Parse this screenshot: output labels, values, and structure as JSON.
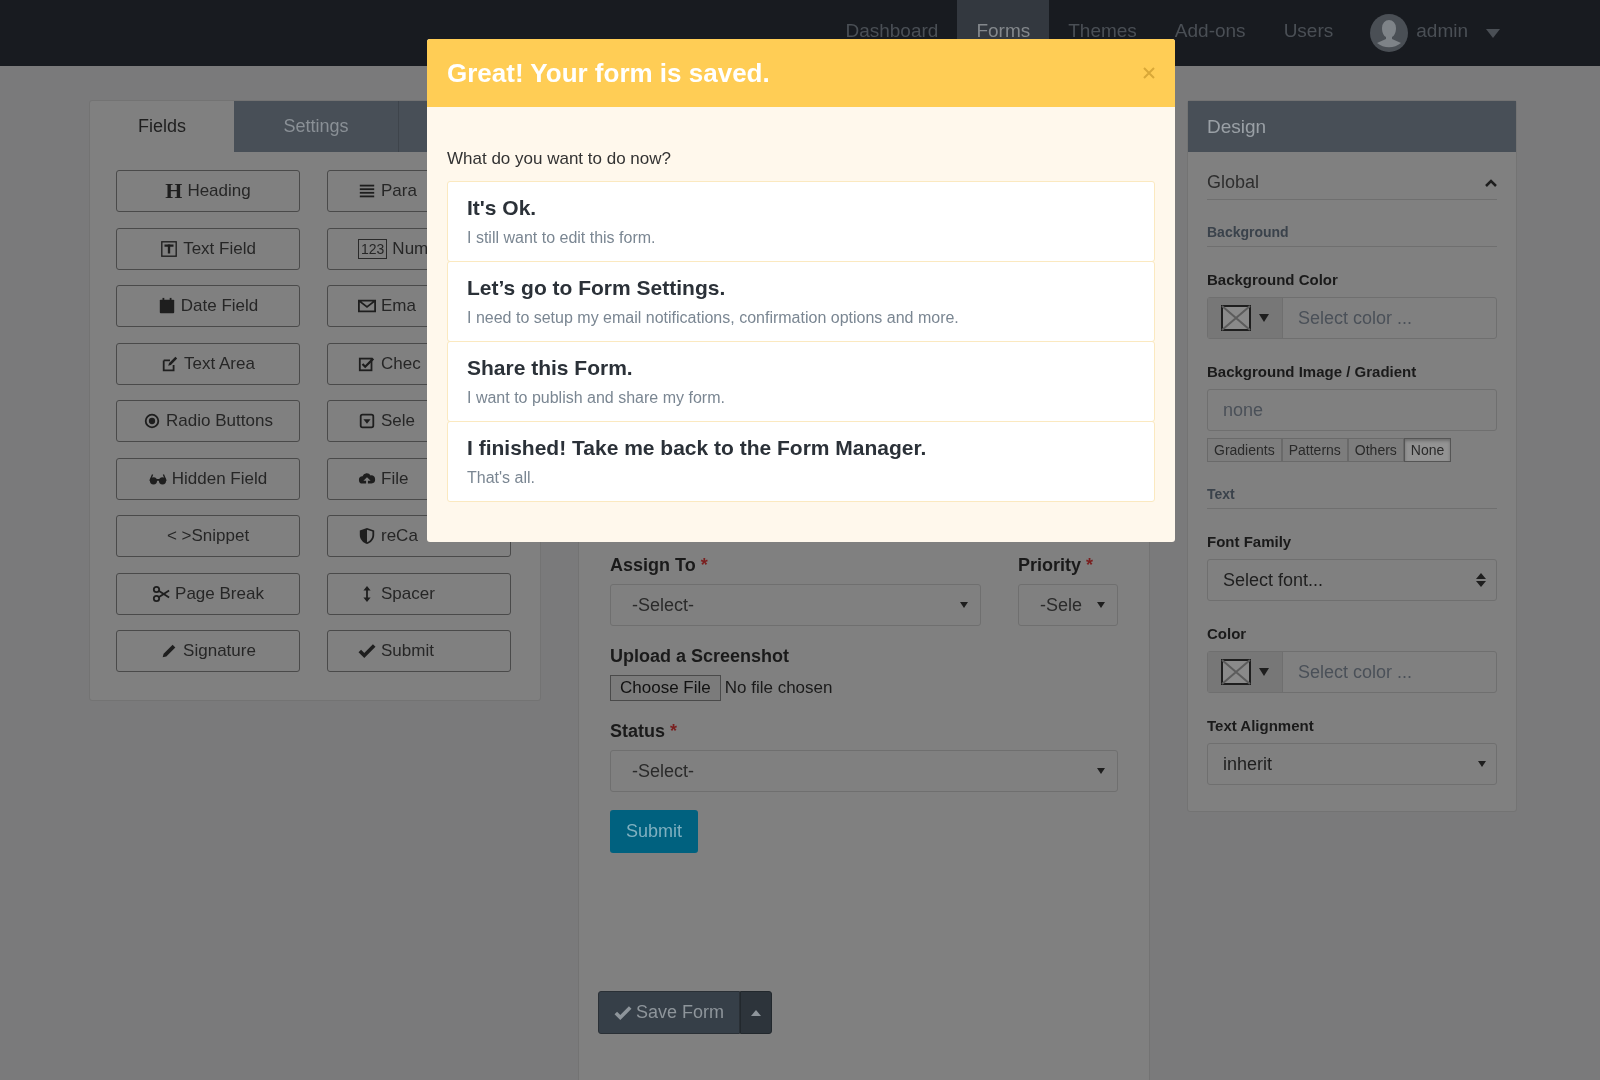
{
  "nav": {
    "items": [
      {
        "label": "Dashboard",
        "selected": false
      },
      {
        "label": "Forms",
        "selected": true
      },
      {
        "label": "Themes",
        "selected": false
      },
      {
        "label": "Add-ons",
        "selected": false
      },
      {
        "label": "Users",
        "selected": false
      }
    ],
    "user": "admin"
  },
  "builder": {
    "tabs": [
      {
        "label": "Fields",
        "selected": true
      },
      {
        "label": "Settings",
        "selected": false
      }
    ],
    "fields": [
      {
        "label": "Heading",
        "kind": "glyph",
        "glyph": "H"
      },
      {
        "label": "Para",
        "kind": "paragraph"
      },
      {
        "label": "Text Field",
        "kind": "textfield"
      },
      {
        "label": "Num",
        "kind": "boxed",
        "glyph": "123"
      },
      {
        "label": "Date Field",
        "kind": "calendar"
      },
      {
        "label": "Ema",
        "kind": "envelope"
      },
      {
        "label": "Text Area",
        "kind": "edit"
      },
      {
        "label": "Chec",
        "kind": "checkbox"
      },
      {
        "label": "Radio Buttons",
        "kind": "radio"
      },
      {
        "label": "Sele",
        "kind": "select"
      },
      {
        "label": "Hidden Field",
        "kind": "glasses"
      },
      {
        "label": "File",
        "kind": "upload"
      },
      {
        "label": "< >Snippet",
        "kind": "plain"
      },
      {
        "label": "reCa",
        "kind": "shield"
      },
      {
        "label": "Page Break",
        "kind": "scissors"
      },
      {
        "label": "Spacer",
        "kind": "updown"
      },
      {
        "label": "Signature",
        "kind": "pencil"
      },
      {
        "label": "Submit",
        "kind": "check"
      }
    ]
  },
  "form": {
    "assign_to": {
      "label": "Assign To",
      "required_mark": "*",
      "value": "-Select-"
    },
    "priority": {
      "label": "Priority",
      "required_mark": "*",
      "value": "-Sele"
    },
    "upload": {
      "label": "Upload a Screenshot",
      "button": "Choose File",
      "status": "No file chosen"
    },
    "status": {
      "label": "Status",
      "required_mark": "*",
      "value": "-Select-"
    },
    "submit": "Submit",
    "save": "Save Form"
  },
  "design": {
    "title": "Design",
    "section": "Global",
    "expanded": true,
    "background_heading": "Background",
    "background_color": {
      "label": "Background Color",
      "placeholder": "Select color ..."
    },
    "background_image": {
      "label": "Background Image / Gradient",
      "value": "none",
      "options": [
        {
          "label": "Gradients",
          "selected": false
        },
        {
          "label": "Patterns",
          "selected": false
        },
        {
          "label": "Others",
          "selected": false
        },
        {
          "label": "None",
          "selected": true
        }
      ]
    },
    "text_heading": "Text",
    "font_family": {
      "label": "Font Family",
      "value": "Select font..."
    },
    "color": {
      "label": "Color",
      "placeholder": "Select color ..."
    },
    "text_alignment": {
      "label": "Text Alignment",
      "value": "inherit"
    }
  },
  "modal": {
    "title": "Great! Your form is saved.",
    "question": "What do you want to do now?",
    "options": [
      {
        "title": "It's Ok.",
        "text": "I still want to edit this form."
      },
      {
        "title": "Let’s go to Form Settings.",
        "text": "I need to setup my email notifications, confirmation options and more."
      },
      {
        "title": "Share this Form.",
        "text": "I want to publish and share my form."
      },
      {
        "title": "I finished! Take me back to the Form Manager.",
        "text": "That's all."
      }
    ]
  }
}
